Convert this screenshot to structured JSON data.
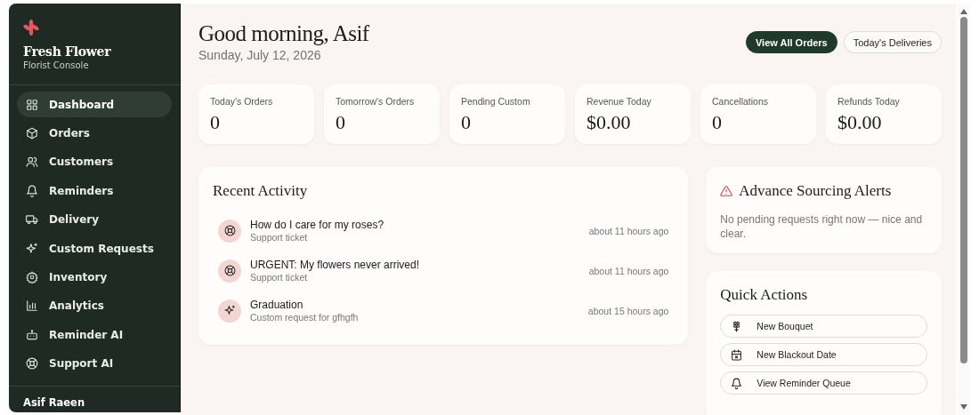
{
  "sidebar": {
    "brand": "Fresh Flower",
    "subtitle": "Florist Console",
    "items": [
      {
        "label": "Dashboard",
        "selected": true
      },
      {
        "label": "Orders",
        "selected": false
      },
      {
        "label": "Customers",
        "selected": false
      },
      {
        "label": "Reminders",
        "selected": false
      },
      {
        "label": "Delivery",
        "selected": false
      },
      {
        "label": "Custom Requests",
        "selected": false
      },
      {
        "label": "Inventory",
        "selected": false
      },
      {
        "label": "Analytics",
        "selected": false
      },
      {
        "label": "Reminder AI",
        "selected": false
      },
      {
        "label": "Support AI",
        "selected": false
      }
    ],
    "user": "Asif Raeen"
  },
  "header": {
    "greeting": "Good morning, Asif",
    "date": "Sunday, July 12, 2026",
    "buttons": [
      {
        "label": "View All Orders",
        "kind": "primary"
      },
      {
        "label": "Today's Deliveries",
        "kind": "secondary"
      }
    ]
  },
  "stats": [
    {
      "label": "Today's Orders",
      "value": "0"
    },
    {
      "label": "Tomorrow's Orders",
      "value": "0"
    },
    {
      "label": "Pending Custom",
      "value": "0"
    },
    {
      "label": "Revenue Today",
      "value": "$0.00"
    },
    {
      "label": "Cancellations",
      "value": "0"
    },
    {
      "label": "Refunds Today",
      "value": "$0.00"
    }
  ],
  "recent_activity": {
    "title": "Recent Activity",
    "items": [
      {
        "kind": "support",
        "title": "How do I care for my roses?",
        "subtitle": "Support ticket",
        "time": "about 11 hours ago"
      },
      {
        "kind": "support",
        "title": "URGENT: My flowers never arrived!",
        "subtitle": "Support ticket",
        "time": "about 11 hours ago"
      },
      {
        "kind": "custom",
        "title": "Graduation",
        "subtitle": "Custom request for gfhgfh",
        "time": "about 15 hours ago"
      }
    ]
  },
  "sourcing_alerts": {
    "title": "Advance Sourcing Alerts",
    "message": "No pending requests right now — nice and clear."
  },
  "quick_actions": {
    "title": "Quick Actions",
    "items": [
      {
        "kind": "bouquet",
        "label": "New Bouquet"
      },
      {
        "kind": "calendar",
        "label": "New Blackout Date"
      },
      {
        "kind": "bell",
        "label": "View Reminder Queue"
      }
    ]
  }
}
